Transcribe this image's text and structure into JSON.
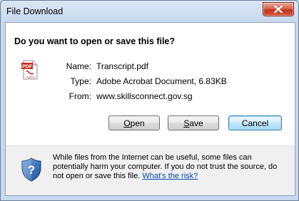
{
  "dialog": {
    "title": "File Download",
    "question": "Do you want to open or save this file?"
  },
  "file": {
    "name_label": "Name:",
    "name_value": "Transcript.pdf",
    "type_label": "Type:",
    "type_value": "Adobe Acrobat Document, 6.83KB",
    "from_label": "From:",
    "from_value": "www.skillsconnect.gov.sg",
    "icon": "pdf-file-icon",
    "icon_badge": "PDF",
    "icon_caption": "Adobe"
  },
  "buttons": {
    "open_mnemonic": "O",
    "open_rest": "pen",
    "save_mnemonic": "S",
    "save_rest": "ave",
    "cancel": "Cancel"
  },
  "warning": {
    "text": "While files from the Internet can be useful, some files can potentially harm your computer. If you do not trust the source, do not open or save this file.",
    "link": "What's the risk?",
    "icon": "security-shield-question-icon"
  },
  "colors": {
    "window_frame": "#c8d8ee",
    "close_button": "#c1351e",
    "link": "#0645ad",
    "default_button_border": "#3c7fb1"
  }
}
